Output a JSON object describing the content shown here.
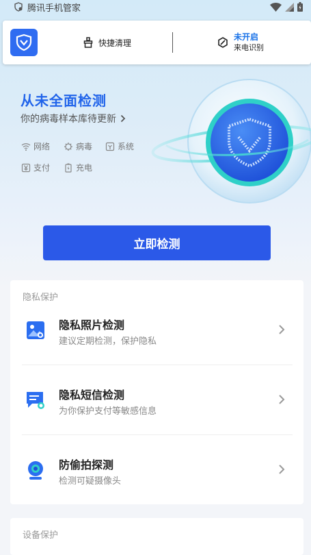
{
  "status_bar": {
    "app_name": "腾讯手机管家"
  },
  "notification": {
    "action_label": "快捷清理",
    "status": "未开启",
    "feature": "来电识别"
  },
  "hero": {
    "title": "从未全面检测",
    "subtitle": "你的病毒样本库待更新",
    "tags": [
      {
        "label": "网络",
        "icon": "wifi-icon"
      },
      {
        "label": "病毒",
        "icon": "virus-icon"
      },
      {
        "label": "系统",
        "icon": "system-icon"
      },
      {
        "label": "支付",
        "icon": "yuan-icon"
      },
      {
        "label": "充电",
        "icon": "battery-icon"
      }
    ],
    "button_label": "立即检测"
  },
  "privacy": {
    "section_title": "隐私保护",
    "items": [
      {
        "title": "隐私照片检测",
        "subtitle": "建议定期检测，保护隐私",
        "icon": "photo-scan-icon"
      },
      {
        "title": "隐私短信检测",
        "subtitle": "为你保护支付等敏感信息",
        "icon": "sms-scan-icon"
      },
      {
        "title": "防偷拍探测",
        "subtitle": "检测可疑摄像头",
        "icon": "webcam-icon"
      }
    ]
  },
  "device": {
    "section_title": "设备保护"
  },
  "colors": {
    "brand_blue": "#2b59e8",
    "title_blue": "#2164ea",
    "status_blue": "#1a73e8"
  }
}
